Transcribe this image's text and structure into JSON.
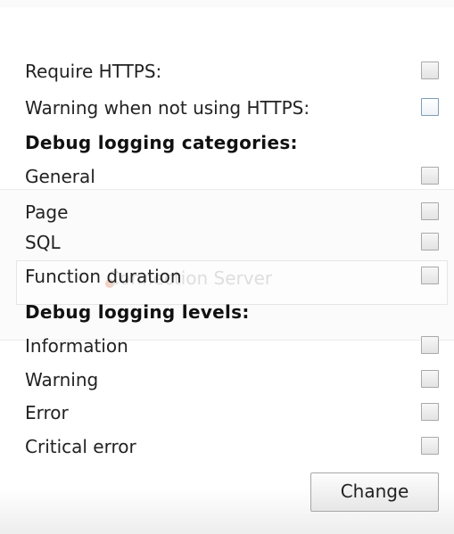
{
  "background": {
    "faded_field_text": "Connection Server"
  },
  "settings": {
    "require_https": {
      "label": "Require HTTPS:",
      "checked": false
    },
    "warning_https": {
      "label": "Warning when not using HTTPS:",
      "checked": false
    },
    "debug_categories_heading": "Debug logging categories:",
    "categories": [
      {
        "label": "General",
        "checked": false
      },
      {
        "label": "Page",
        "checked": false
      },
      {
        "label": "SQL",
        "checked": false
      },
      {
        "label": "Function duration",
        "checked": false
      }
    ],
    "debug_levels_heading": "Debug logging levels:",
    "levels": [
      {
        "label": "Information",
        "checked": false
      },
      {
        "label": "Warning",
        "checked": false
      },
      {
        "label": "Error",
        "checked": false
      },
      {
        "label": "Critical error",
        "checked": false
      }
    ],
    "change_button": "Change"
  }
}
